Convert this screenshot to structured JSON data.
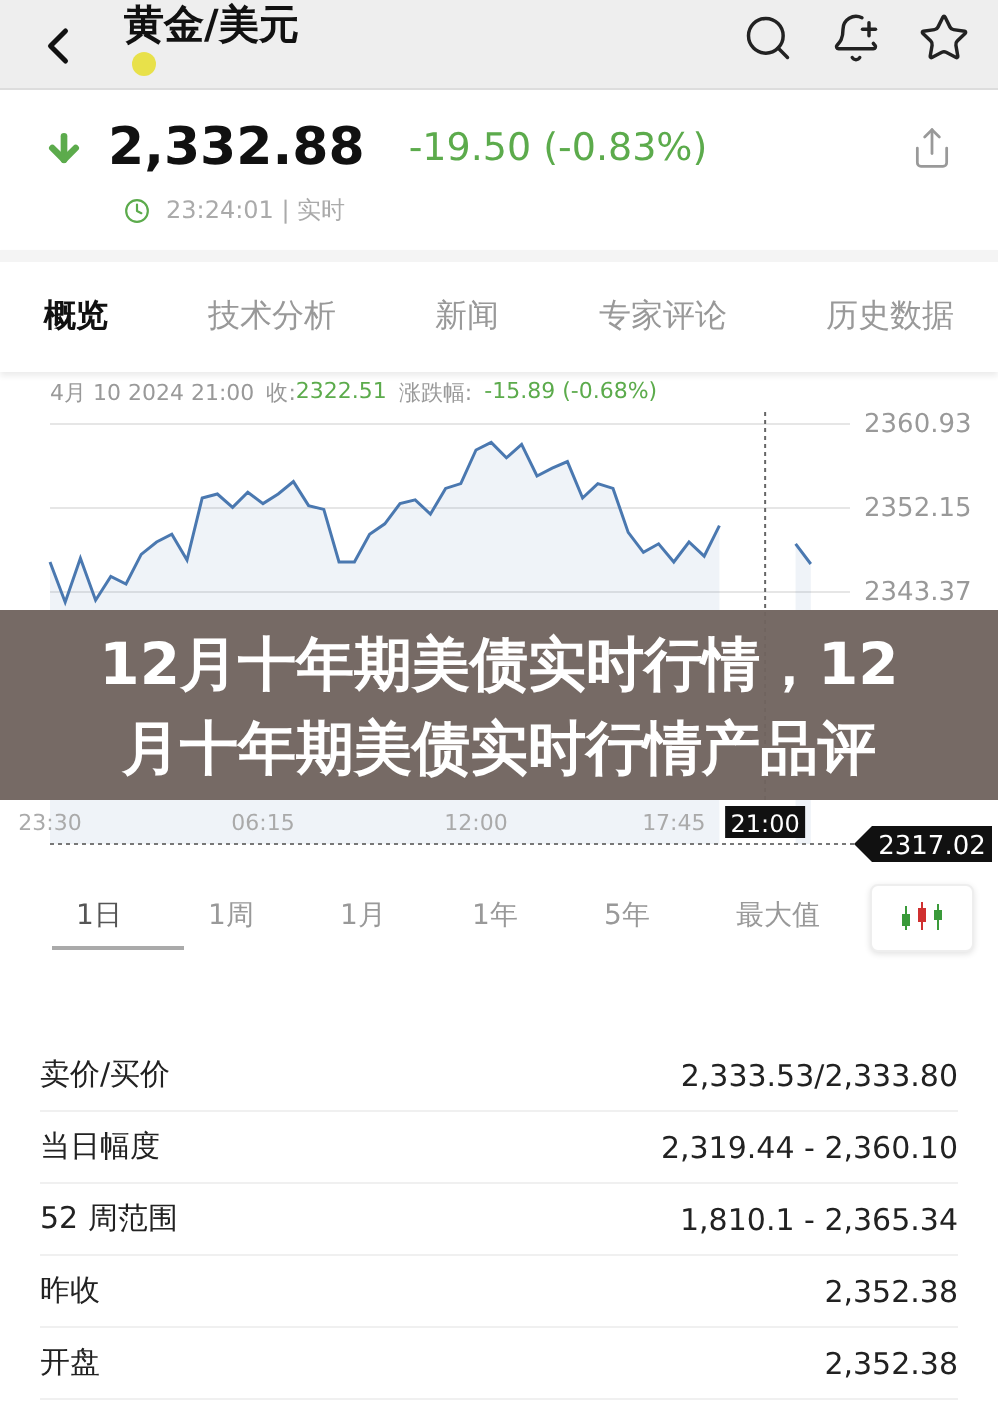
{
  "nav": {
    "title": "黄金/美元"
  },
  "quote": {
    "price": "2,332.88",
    "change": "-19.50 (-0.83%)",
    "falling": true,
    "time": "23:24:01 | 实时"
  },
  "tabs": [
    {
      "label": "概览",
      "selected": true
    },
    {
      "label": "技术分析",
      "selected": false
    },
    {
      "label": "新闻",
      "selected": false
    },
    {
      "label": "专家评论",
      "selected": false
    },
    {
      "label": "历史数据",
      "selected": false
    }
  ],
  "chart": {
    "info": {
      "date": "4月 10 2024 21:00",
      "close_label": "收:",
      "close": "2322.51",
      "change_label": "涨跌幅:",
      "change": "-15.89 (-0.68%)"
    },
    "chart_data": {
      "type": "area",
      "categories": [
        "23:30",
        null,
        null,
        null,
        null,
        null,
        null,
        null,
        null,
        null,
        null,
        null,
        null,
        null,
        "06:15",
        null,
        null,
        null,
        null,
        null,
        null,
        null,
        null,
        null,
        null,
        null,
        null,
        null,
        "12:00",
        null,
        null,
        null,
        null,
        null,
        null,
        null,
        null,
        null,
        null,
        null,
        null,
        "17:45",
        null,
        null,
        null,
        null,
        null,
        "21:00",
        null,
        null,
        null,
        null
      ],
      "grid": true,
      "series": [
        {
          "color": "#4a78b0",
          "values": [
            2346.5,
            2342.3,
            2346.9,
            2342.5,
            2345.0,
            2344.2,
            2347.3,
            2348.6,
            2349.4,
            2346.7,
            2353.2,
            2353.6,
            2352.2,
            2353.8,
            2352.6,
            2353.6,
            2354.9,
            2352.4,
            2352.0,
            2346.5,
            2346.5,
            2349.4,
            2350.5,
            2352.6,
            2353.0,
            2351.5,
            2354.2,
            2354.7,
            2358.2,
            2359.0,
            2357.4,
            2358.8,
            2355.5,
            2356.3,
            2357.0,
            2353.2,
            2354.7,
            2354.2,
            2349.6,
            2347.5,
            2348.4,
            2346.5,
            2348.6,
            2347.1,
            2350.3,
            null,
            null,
            null,
            null,
            2348.4,
            2346.3,
            null
          ]
        }
      ],
      "ylim": [
        2317.02,
        2362.6
      ],
      "yticks": [
        {
          "value": 2360.93,
          "label": "2360.93"
        },
        {
          "value": 2352.15,
          "label": "2352.15"
        },
        {
          "value": 2343.37,
          "label": "2343.37"
        }
      ],
      "annotations": [
        {
          "x": "21:00"
        },
        "2317.02"
      ]
    }
  },
  "ranges": [
    {
      "label": "1日",
      "selected": true
    },
    {
      "label": "1周",
      "selected": false
    },
    {
      "label": "1月",
      "selected": false
    },
    {
      "label": "1年",
      "selected": false
    },
    {
      "label": "5年",
      "selected": false
    },
    {
      "label": "最大值",
      "selected": false
    }
  ],
  "stats": [
    {
      "label": "卖价/买价",
      "value": "2,333.53/2,333.80"
    },
    {
      "label": "当日幅度",
      "value": "2,319.44 - 2,360.10"
    },
    {
      "label": "52 周范围",
      "value": "1,810.1 - 2,365.34"
    },
    {
      "label": "昨收",
      "value": "2,352.38"
    },
    {
      "label": "开盘",
      "value": "2,352.38"
    }
  ],
  "banner": "12月十年期美债实时行情，12月十年期美债实时行情产品评"
}
